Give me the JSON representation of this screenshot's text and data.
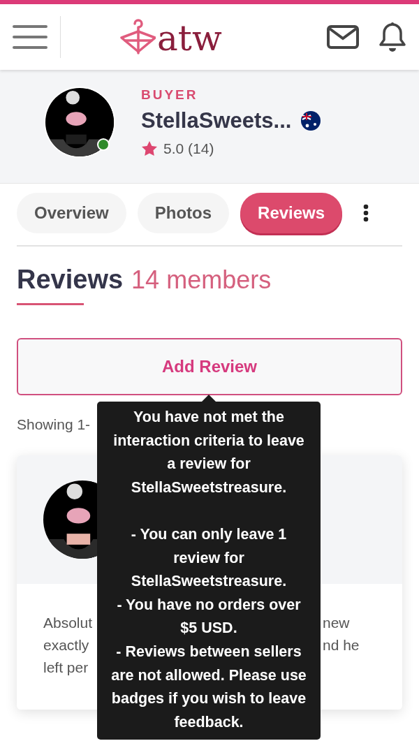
{
  "header": {
    "logo": "atw"
  },
  "profile": {
    "role": "BUYER",
    "name": "StellaSweets...",
    "online": true,
    "rating": "5.0 (14)"
  },
  "tabs": [
    {
      "label": "Overview",
      "selected": false
    },
    {
      "label": "Photos",
      "selected": false
    },
    {
      "label": "Reviews",
      "selected": true
    }
  ],
  "reviews": {
    "title": "Reviews",
    "count": "14 members",
    "add_button": "Add Review",
    "showing": "Showing 1-",
    "items": [
      {
        "lines": [
          {
            "left": "Absolut",
            "right": "new"
          },
          {
            "left": "exactly",
            "right": "nd he"
          },
          {
            "left": "left per"
          }
        ]
      }
    ]
  },
  "tooltip": {
    "text": "You have not met the interaction criteria to leave a review for StellaSweetstreasure.\n\n- You can only leave 1 review for StellaSweetstreasure.\n- You have no orders over $5 USD.\n- Reviews between sellers are not allowed. Please use badges if you wish to leave feedback."
  }
}
